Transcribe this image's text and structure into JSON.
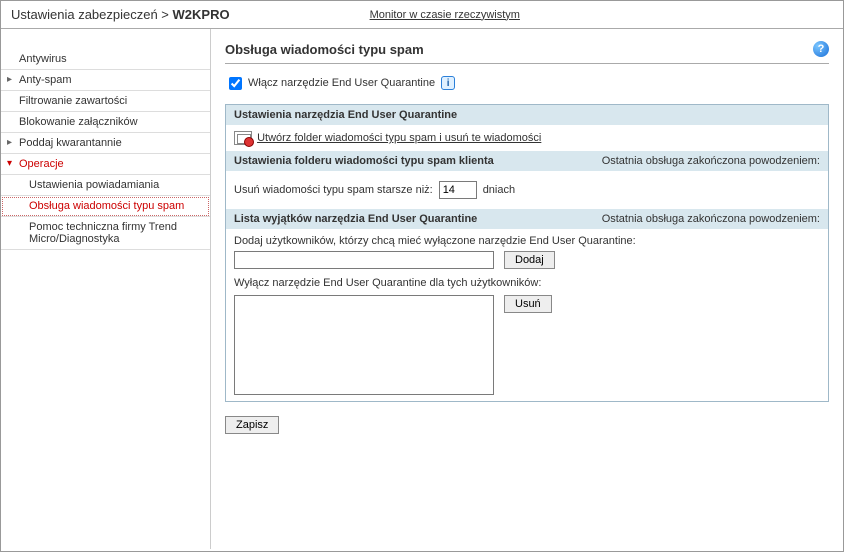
{
  "breadcrumb": {
    "prefix": "Ustawienia zabezpieczeń > ",
    "target": "W2KPRO"
  },
  "top_link": "Monitor w czasie rzeczywistym",
  "sidebar": {
    "items": [
      {
        "label": "Antywirus"
      },
      {
        "label": "Anty-spam"
      },
      {
        "label": "Filtrowanie zawartości"
      },
      {
        "label": "Blokowanie załączników"
      },
      {
        "label": "Poddaj kwarantannie"
      },
      {
        "label": "Operacje"
      },
      {
        "label": "Ustawienia powiadamiania"
      },
      {
        "label": "Obsługa wiadomości typu spam"
      },
      {
        "label": "Pomoc techniczna firmy Trend Micro/Diagnostyka"
      }
    ]
  },
  "main": {
    "title": "Obsługa wiadomości typu spam",
    "enable_checkbox": "Włącz narzędzie End User Quarantine",
    "enable_checked": true,
    "sections": {
      "euq_settings": {
        "header": "Ustawienia narzędzia End User Quarantine",
        "link": "Utwórz folder wiadomości typu spam i usuń te wiadomości"
      },
      "folder_settings": {
        "header": "Ustawienia folderu wiadomości typu spam klienta",
        "status": "Ostatnia obsługa zakończona powodzeniem:",
        "delete_label_pre": "Usuń wiadomości typu spam starsze niż:",
        "delete_value": "14",
        "delete_label_post": "dniach"
      },
      "exceptions": {
        "header": "Lista wyjątków narzędzia End User Quarantine",
        "status": "Ostatnia obsługa zakończona powodzeniem:",
        "add_label": "Dodaj użytkowników, którzy chcą mieć wyłączone narzędzie End User Quarantine:",
        "add_button": "Dodaj",
        "exclude_label": "Wyłącz narzędzie End User Quarantine dla tych użytkowników:",
        "remove_button": "Usuń"
      }
    },
    "save_button": "Zapisz"
  }
}
